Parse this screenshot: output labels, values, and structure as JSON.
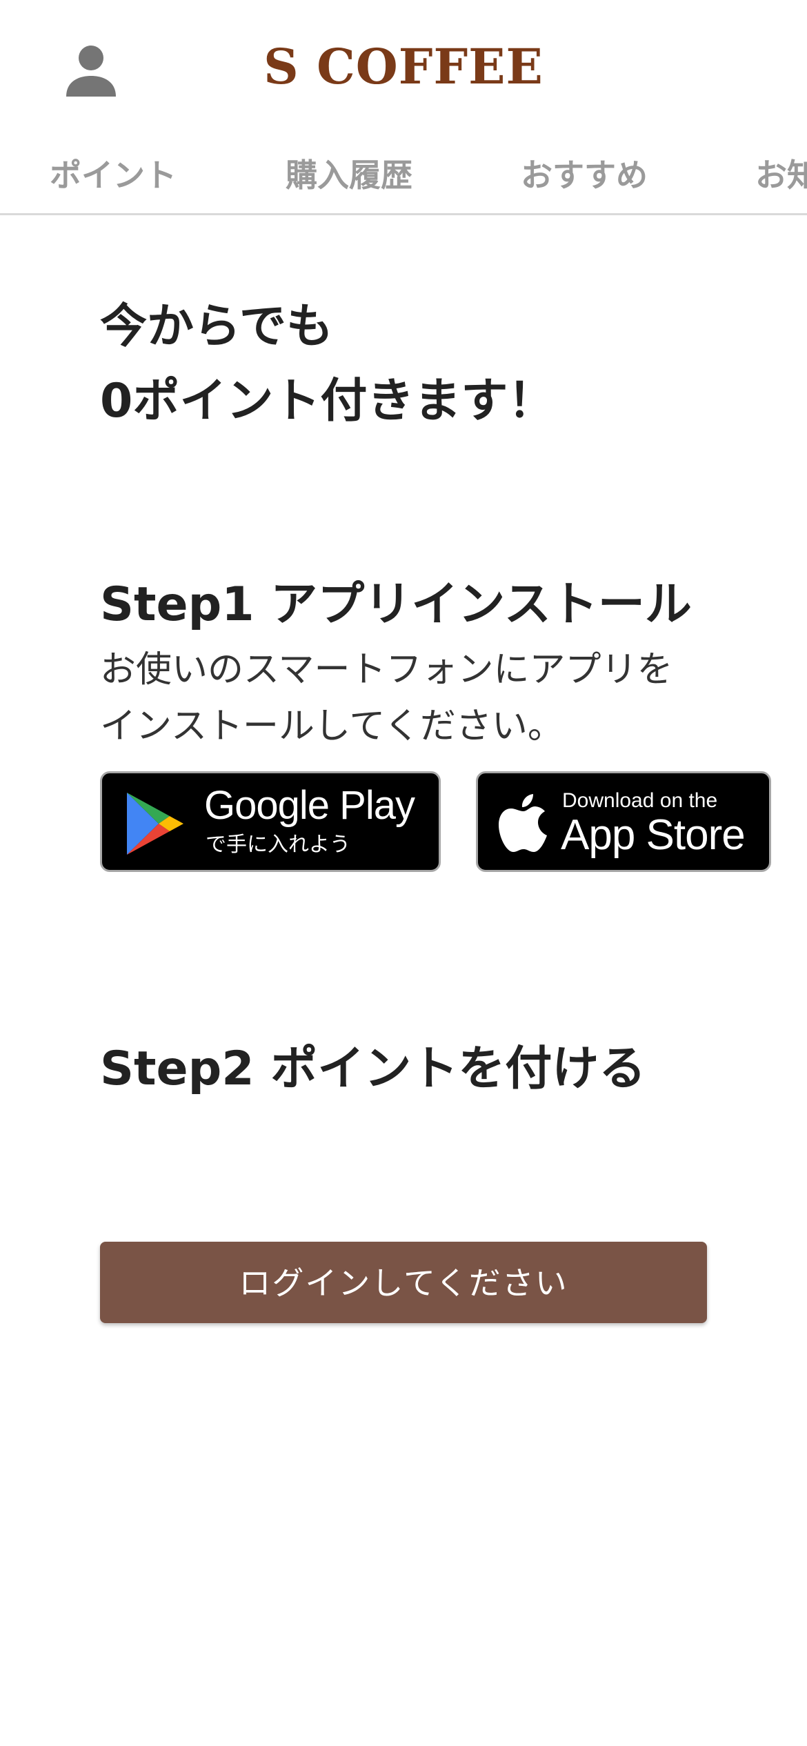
{
  "header": {
    "brand": "S COFFEE",
    "avatar_icon": "person-icon"
  },
  "tabs": [
    {
      "label": "ポイント"
    },
    {
      "label": "購入履歴"
    },
    {
      "label": "おすすめ"
    },
    {
      "label": "お知"
    }
  ],
  "headline": {
    "line1": "今からでも",
    "line2": "0ポイント付きます！"
  },
  "step1": {
    "title": "Step1 アプリインストール",
    "desc_line1": "お使いのスマートフォンにアプリを",
    "desc_line2": "インストールしてください。"
  },
  "badges": {
    "google_play": {
      "main": "Google Play",
      "sub": "で手に入れよう",
      "icon": "google-play-icon"
    },
    "app_store": {
      "sub": "Download on the",
      "main": "App Store",
      "icon": "apple-icon"
    }
  },
  "step2": {
    "title": "Step2 ポイントを付ける"
  },
  "login_button": {
    "label": "ログインしてください"
  },
  "colors": {
    "brand": "#7a3a18",
    "button": "#7a5446",
    "tab_text": "#9a9a9a",
    "heading": "#222222"
  }
}
